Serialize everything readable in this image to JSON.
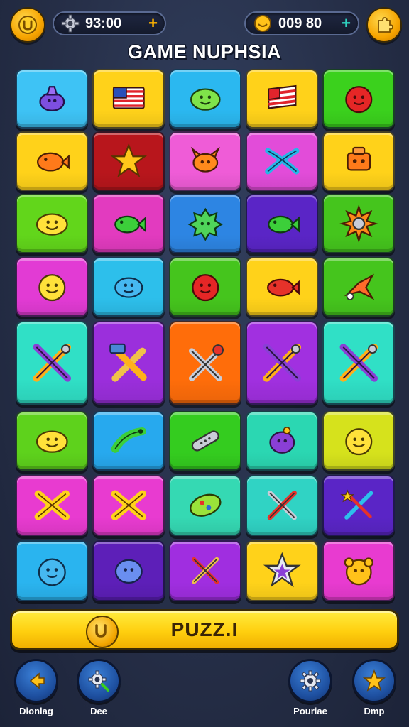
{
  "header": {
    "left_currency": "93:00",
    "right_currency": "009 80",
    "plus_symbol": "+",
    "title": "GAME NUPHSIA"
  },
  "board": {
    "rows": [
      [
        {
          "color": "#3ec3f5",
          "icon": "purple-alien-icon"
        },
        {
          "color": "#ffd21a",
          "icon": "us-flag-icon"
        },
        {
          "color": "#2bb8f0",
          "icon": "green-blob-icon"
        },
        {
          "color": "#ffd21a",
          "icon": "flag-icon"
        },
        {
          "color": "#3bd11d",
          "icon": "red-ball-icon"
        }
      ],
      [
        {
          "color": "#ffd21a",
          "icon": "orange-fish-icon"
        },
        {
          "color": "#b8161c",
          "icon": "star-icon"
        },
        {
          "color": "#ef5cd7",
          "icon": "orange-creature-icon"
        },
        {
          "color": "#e24cd9",
          "icon": "crossed-fins-icon"
        },
        {
          "color": "#ffd21a",
          "icon": "orange-robot-icon"
        }
      ],
      [
        {
          "color": "#62d61b",
          "icon": "lemon-face-icon"
        },
        {
          "color": "#e23bbf",
          "icon": "green-fish-icon"
        },
        {
          "color": "#2d85e3",
          "icon": "green-monster-icon"
        },
        {
          "color": "#5a25c6",
          "icon": "green-fish-icon"
        },
        {
          "color": "#45c51d",
          "icon": "gear-burst-icon"
        }
      ],
      [
        {
          "color": "#e23bd4",
          "icon": "smiley-face-icon"
        },
        {
          "color": "#2dbfeb",
          "icon": "blue-fish-icon"
        },
        {
          "color": "#45c51d",
          "icon": "red-ball-icon"
        },
        {
          "color": "#ffd21a",
          "icon": "red-fish-icon"
        },
        {
          "color": "#45c51d",
          "icon": "bird-icon"
        }
      ],
      [
        {
          "color": "#30e0c6",
          "icon": "crossed-tools-icon"
        },
        {
          "color": "#9b2fdc",
          "icon": "crossed-hammer-icon"
        },
        {
          "color": "#ff6d0a",
          "icon": "crossed-wrench-icon"
        },
        {
          "color": "#a130e0",
          "icon": "crossed-tools-icon"
        },
        {
          "color": "#30e0c6",
          "icon": "crossed-tools-icon"
        }
      ],
      [
        {
          "color": "#5ed21c",
          "icon": "lemon-face-icon"
        },
        {
          "color": "#27a9ee",
          "icon": "green-worm-icon"
        },
        {
          "color": "#34cc1f",
          "icon": "bandage-icon"
        },
        {
          "color": "#2bd7b2",
          "icon": "purple-blob-icon"
        },
        {
          "color": "#d6e21c",
          "icon": "smiley-face-icon"
        }
      ],
      [
        {
          "color": "#e83bd0",
          "icon": "yellow-bow-icon"
        },
        {
          "color": "#e83bd0",
          "icon": "yellow-bow-icon"
        },
        {
          "color": "#35d9b3",
          "icon": "green-leaf-icon"
        },
        {
          "color": "#30d3c4",
          "icon": "crossed-pencils-icon"
        },
        {
          "color": "#5a25c6",
          "icon": "magic-wand-icon"
        }
      ],
      [
        {
          "color": "#2ab4ef",
          "icon": "blue-ball-icon"
        },
        {
          "color": "#5d1fb8",
          "icon": "blue-blob-icon"
        },
        {
          "color": "#a02ee0",
          "icon": "crossed-sticks-icon"
        },
        {
          "color": "#ffd21a",
          "icon": "rainbow-star-icon"
        },
        {
          "color": "#e83bd0",
          "icon": "bear-face-icon"
        }
      ]
    ]
  },
  "puzzle_button": {
    "label": "PUZZ.I"
  },
  "nav": [
    {
      "label": "Dionlag",
      "icon": "arrow-left-icon"
    },
    {
      "label": "Dee",
      "icon": "settings-search-icon"
    },
    {
      "label": "Pouriae",
      "icon": "gear-icon"
    },
    {
      "label": "Dmp",
      "icon": "star-icon"
    }
  ]
}
